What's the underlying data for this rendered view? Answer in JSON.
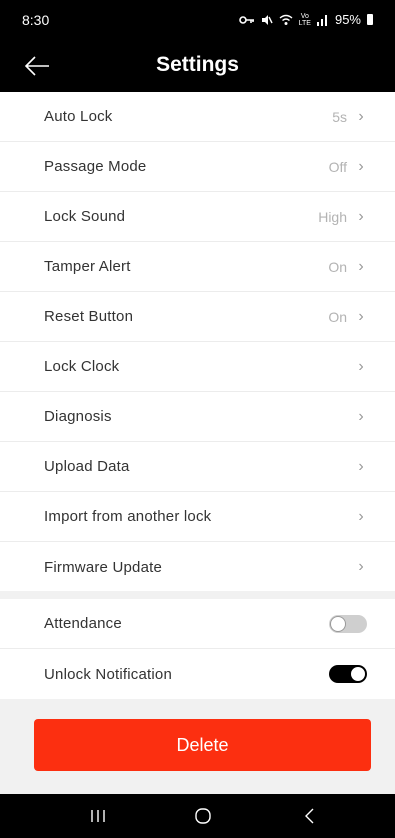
{
  "status_bar": {
    "time": "8:30",
    "battery": "95%",
    "icons": [
      "key-icon",
      "mute-icon",
      "wifi-calling-icon",
      "volte-icon",
      "signal-icon",
      "battery-icon"
    ]
  },
  "header": {
    "title": "Settings"
  },
  "settings": [
    {
      "label": "Auto Lock",
      "value": "5s"
    },
    {
      "label": "Passage Mode",
      "value": "Off"
    },
    {
      "label": "Lock Sound",
      "value": "High"
    },
    {
      "label": "Tamper Alert",
      "value": "On"
    },
    {
      "label": "Reset Button",
      "value": "On"
    },
    {
      "label": "Lock Clock",
      "value": ""
    },
    {
      "label": "Diagnosis",
      "value": ""
    },
    {
      "label": "Upload Data",
      "value": ""
    },
    {
      "label": "Import from another lock",
      "value": ""
    },
    {
      "label": "Firmware Update",
      "value": ""
    }
  ],
  "toggles": [
    {
      "label": "Attendance",
      "on": false
    },
    {
      "label": "Unlock Notification",
      "on": true
    }
  ],
  "delete_label": "Delete",
  "chevron": "›",
  "colors": {
    "accent": "#fc2f10",
    "header": "#000000",
    "toggle_on": "#000000",
    "toggle_off": "#cfcfcf"
  }
}
